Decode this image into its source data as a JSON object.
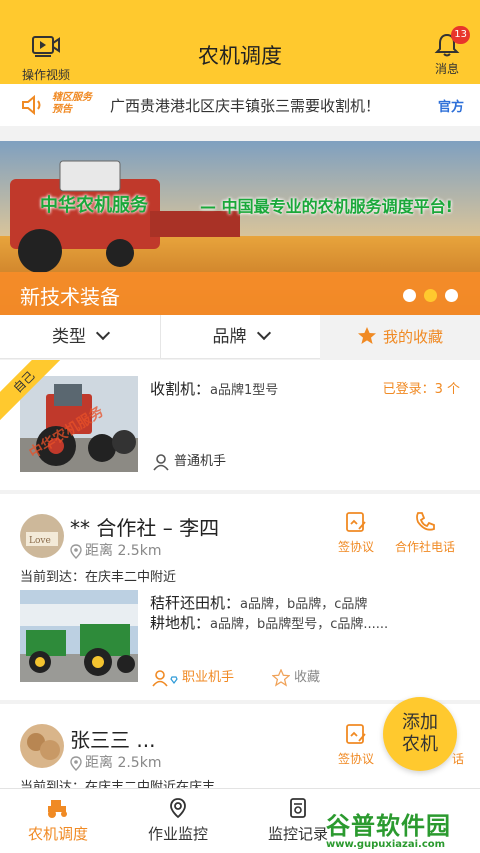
{
  "header": {
    "title": "农机调度",
    "left_label": "操作视频",
    "right_label": "消息",
    "badge_count": "13"
  },
  "notice": {
    "tag_line1": "辖区服务",
    "tag_line2": "预告",
    "message": "广西贵港港北区庆丰镇张三需要收割机！",
    "official": "官方"
  },
  "banner": {
    "slogan_brand": "中华农机服务",
    "slogan_rest": "— 中国最专业的农机服务调度平台!",
    "caption": "新技术装备",
    "active_dot": 1
  },
  "filters": {
    "type": "类型",
    "brand": "品牌",
    "favorites": "我的收藏"
  },
  "cards": [
    {
      "ribbon": "自己",
      "watermark": "中华农机服务",
      "machine_label": "收割机：",
      "machine_value": "a品牌1型号",
      "logged_in": "已登录：3 个",
      "role": "普通机手"
    },
    {
      "name": "** 合作社 – 李四",
      "distance": "距离 2.5km",
      "action1": "签协议",
      "action2": "合作社电话",
      "arrived": "当前到达：在庆丰二中附近",
      "line1_label": "秸秆还田机：",
      "line1_value": "a品牌，b品牌，c品牌",
      "line2_label": "耕地机：",
      "line2_value": "a品牌，b品牌型号，c品牌......",
      "role": "职业机手",
      "favorite": "收藏"
    },
    {
      "name": "张三三 ...",
      "distance": "距离 2.5km",
      "action1": "签协议",
      "action2_partial": "话",
      "arrived": "当前到达：在庆丰二中附近在庆丰"
    }
  ],
  "fab": {
    "line1": "添加",
    "line2": "农机"
  },
  "tabs": [
    {
      "label": "农机调度",
      "active": true
    },
    {
      "label": "作业监控",
      "active": false
    },
    {
      "label": "监控记录",
      "active": false
    }
  ],
  "watermark": {
    "big": "谷普软件园",
    "small": "www.gupuxiazai.com"
  },
  "colors": {
    "brand_yellow": "#ffc92e",
    "accent_orange": "#f08a24",
    "official_blue": "#2d6fd8",
    "badge_red": "#e8352b"
  }
}
